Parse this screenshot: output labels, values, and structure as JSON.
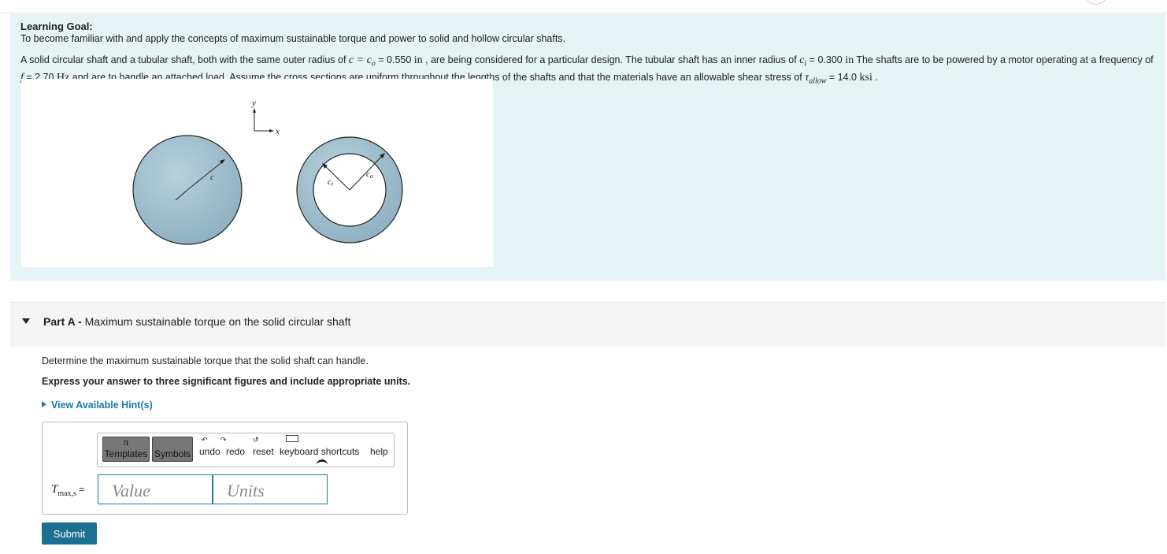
{
  "learning_goal": {
    "title": "Learning Goal:",
    "text": "To become familiar with and apply the concepts of maximum sustainable torque and  power to solid and hollow circular shafts."
  },
  "problem": {
    "p1": "A solid circular shaft and a tubular shaft, both with the same outer radius of ",
    "c_sym": "c = c",
    "c_sub": "o",
    "p2": " = 0.550 ",
    "unit_in": "in",
    "p3": " , are being considered for a particular design. The tubular shaft has an inner radius of ",
    "ci_sym": "c",
    "ci_sub": "i",
    "p4": " = 0.300 ",
    "p5": " The shafts are to be powered by a motor operating at a frequency of ",
    "f_sym": "f",
    "p6": " = 2.70 ",
    "unit_hz": "Hz",
    "p7": " and are to handle an attached load. Assume the cross sections are uniform throughout the lengths of the shafts and that the materials have an allowable shear stress of ",
    "tau_sym": "τ",
    "tau_sub": "allow",
    "p8": " = 14.0 ",
    "unit_ksi": "ksi",
    "p9": " ."
  },
  "figure": {
    "axis_y": "y",
    "axis_x": "x",
    "solid_label": "c",
    "inner_label": "c",
    "inner_sub": "i",
    "outer_label": "c",
    "outer_sub": "o",
    "colors": {
      "shaft_fill": "#96b8c8",
      "outline": "#222222"
    }
  },
  "part_a": {
    "label": "Part A - ",
    "title": "Maximum sustainable torque on the solid circular shaft",
    "question": "Determine the maximum sustainable torque that the solid shaft can handle.",
    "instruction": "Express your answer to three significant figures and include appropriate units.",
    "hint_link": "View Available Hint(s)"
  },
  "toolbar": {
    "templates": "Templates",
    "symbols": "Symbols",
    "undo": "undo",
    "redo": "redo",
    "reset": "reset",
    "keyboard": "keyboard shortcuts",
    "help": "help"
  },
  "answer": {
    "label_sym": "T",
    "label_sub": "max,s",
    "label_eq": " =",
    "value_placeholder": "Value",
    "units_placeholder": "Units"
  },
  "submit_label": "Submit",
  "colors": {
    "intro_bg": "#e5f4f4",
    "accent": "#1a7aa7",
    "button": "#1d6f8f"
  }
}
